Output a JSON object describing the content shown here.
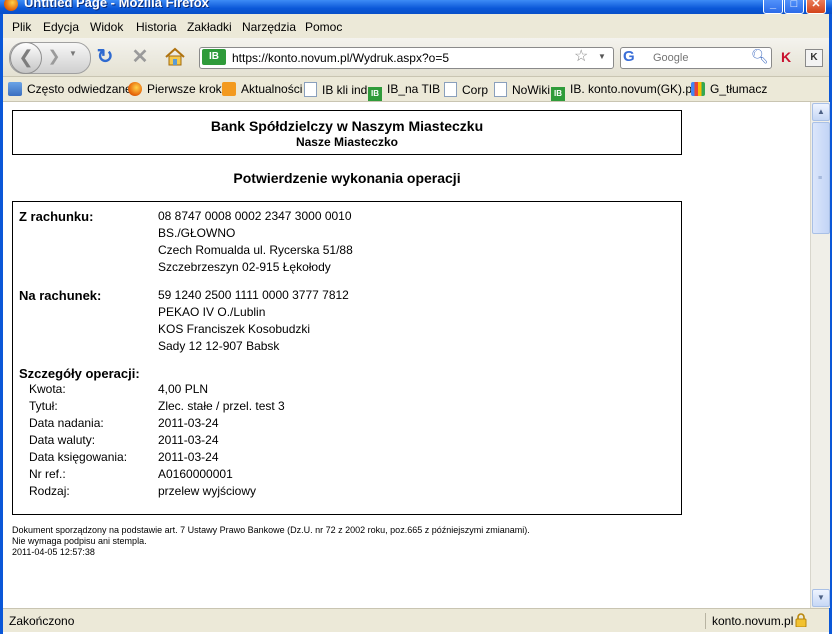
{
  "window": {
    "title": "Untitled Page - Mozilla Firefox",
    "min_glyph": "_",
    "max_glyph": "□",
    "close_glyph": "✕"
  },
  "menu": {
    "items": [
      "Plik",
      "Edycja",
      "Widok",
      "Historia",
      "Zakładki",
      "Narzędzia",
      "Pomoc"
    ]
  },
  "nav": {
    "back_glyph": "❮",
    "forward_glyph": "❯",
    "reload_glyph": "↻",
    "stop_glyph": "✕",
    "site_badge": "IB",
    "url": "https://konto.novum.pl/Wydruk.aspx?o=5",
    "search_engine_glyph": "G",
    "search_placeholder": "Google",
    "ext_k1": "K",
    "ext_k2": "K"
  },
  "bookmarks": [
    {
      "label": "Często odwiedzane",
      "icon": "star-icon"
    },
    {
      "label": "Pierwsze kroki",
      "icon": "firefox-icon"
    },
    {
      "label": "Aktualności",
      "icon": "rss-icon"
    },
    {
      "label": "IB kli ind",
      "icon": "page-icon"
    },
    {
      "label": "IB_na TIB",
      "icon": "ib-icon"
    },
    {
      "label": "Corp",
      "icon": "page-icon"
    },
    {
      "label": "NoWiki",
      "icon": "page-icon"
    },
    {
      "label": "IB. konto.novum(GK).pl",
      "icon": "ib-icon"
    },
    {
      "label": "G_tłumacz",
      "icon": "google-translate-icon"
    }
  ],
  "document": {
    "bank_name": "Bank Spółdzielczy w Naszym Miasteczku",
    "bank_city": "Nasze Miasteczko",
    "title": "Potwierdzenie wykonania operacji",
    "from_account": {
      "label": "Z rachunku:",
      "lines": [
        "08 8747 0008 0002 2347 3000 0010",
        "BS./GŁOWNO",
        "Czech Romualda ul. Rycerska 51/88",
        "Szczebrzeszyn 02-915 Łękołody"
      ]
    },
    "to_account": {
      "label": "Na rachunek:",
      "lines": [
        "59 1240 2500 1111 0000 3777 7812",
        "PEKAO IV O./Lublin",
        "KOS Franciszek Kosobudzki",
        "Sady 12 12-907 Babsk"
      ]
    },
    "details": {
      "heading": "Szczegóły operacji:",
      "rows": [
        {
          "label": "Kwota:",
          "value": "4,00 PLN"
        },
        {
          "label": "Tytuł:",
          "value": "Zlec. stałe / przel. test 3"
        },
        {
          "label": "Data nadania:",
          "value": "2011-03-24"
        },
        {
          "label": "Data waluty:",
          "value": "2011-03-24"
        },
        {
          "label": "Data księgowania:",
          "value": "2011-03-24"
        },
        {
          "label": "Nr ref.:",
          "value": "A0160000001"
        },
        {
          "label": "Rodzaj:",
          "value": "przelew wyjściowy"
        }
      ]
    },
    "footer": [
      "Dokument sporządzony na podstawie art. 7 Ustawy Prawo Bankowe (Dz.U. nr 72 z 2002 roku, poz.665 z późniejszymi zmianami).",
      "Nie wymaga podpisu ani stempla.",
      "2011-04-05 12:57:38"
    ]
  },
  "status": {
    "text": "Zakończono",
    "domain": "konto.novum.pl"
  }
}
